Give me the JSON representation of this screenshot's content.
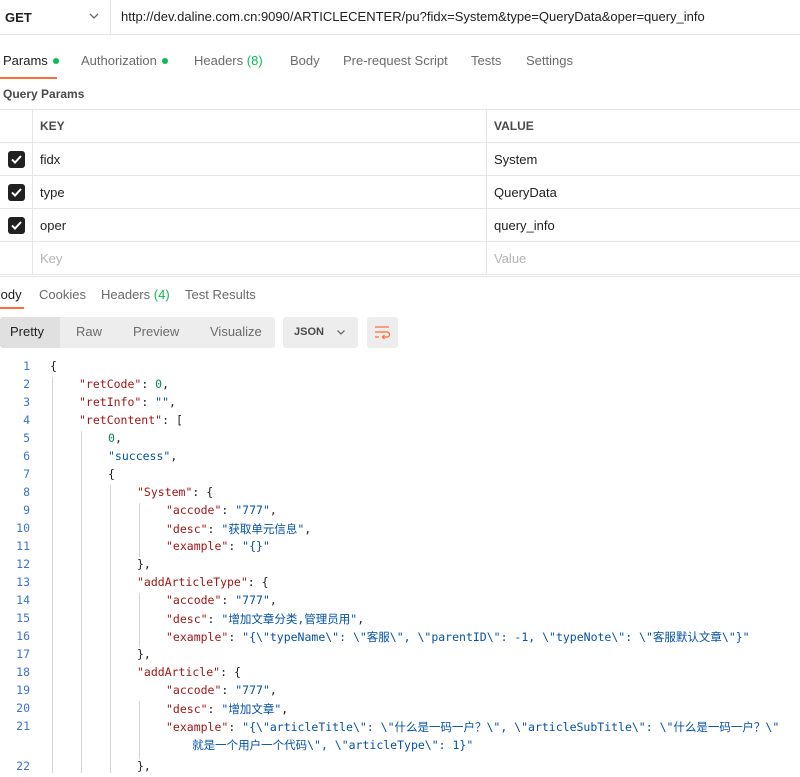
{
  "request": {
    "method": "GET",
    "url": "http://dev.daline.com.cn:9090/ARTICLECENTER/pu?fidx=System&type=QueryData&oper=query_info"
  },
  "req_tabs": {
    "params": "Params",
    "authorization": "Authorization",
    "headers": "Headers",
    "headers_count": "(8)",
    "body": "Body",
    "prerequest": "Pre-request Script",
    "tests": "Tests",
    "settings": "Settings"
  },
  "query_params": {
    "title": "Query Params",
    "col_key": "KEY",
    "col_value": "VALUE",
    "rows": [
      {
        "key": "fidx",
        "value": "System"
      },
      {
        "key": "type",
        "value": "QueryData"
      },
      {
        "key": "oper",
        "value": "query_info"
      }
    ],
    "placeholder_key": "Key",
    "placeholder_value": "Value"
  },
  "resp_tabs": {
    "body": "Body",
    "cookies": "Cookies",
    "headers": "Headers",
    "headers_count": "(4)",
    "test_results": "Test Results"
  },
  "view_modes": [
    "Pretty",
    "Raw",
    "Preview",
    "Visualize"
  ],
  "format": "JSON",
  "code_lines": [
    {
      "n": "1",
      "d": 0,
      "p": [
        [
          "p",
          "{"
        ]
      ]
    },
    {
      "n": "2",
      "d": 1,
      "p": [
        [
          "k",
          "\"retCode\""
        ],
        [
          "p",
          ": "
        ],
        [
          "n",
          "0"
        ],
        [
          "p",
          ","
        ]
      ]
    },
    {
      "n": "3",
      "d": 1,
      "p": [
        [
          "k",
          "\"retInfo\""
        ],
        [
          "p",
          ": "
        ],
        [
          "s",
          "\"\""
        ],
        [
          "p",
          ","
        ]
      ]
    },
    {
      "n": "4",
      "d": 1,
      "p": [
        [
          "k",
          "\"retContent\""
        ],
        [
          "p",
          ": ["
        ]
      ]
    },
    {
      "n": "5",
      "d": 2,
      "p": [
        [
          "n",
          "0"
        ],
        [
          "p",
          ","
        ]
      ]
    },
    {
      "n": "6",
      "d": 2,
      "p": [
        [
          "s",
          "\"success\""
        ],
        [
          "p",
          ","
        ]
      ]
    },
    {
      "n": "7",
      "d": 2,
      "p": [
        [
          "p",
          "{"
        ]
      ]
    },
    {
      "n": "8",
      "d": 3,
      "p": [
        [
          "k",
          "\"System\""
        ],
        [
          "p",
          ": {"
        ]
      ]
    },
    {
      "n": "9",
      "d": 4,
      "p": [
        [
          "k",
          "\"accode\""
        ],
        [
          "p",
          ": "
        ],
        [
          "s",
          "\"777\""
        ],
        [
          "p",
          ","
        ]
      ]
    },
    {
      "n": "10",
      "d": 4,
      "p": [
        [
          "k",
          "\"desc\""
        ],
        [
          "p",
          ": "
        ],
        [
          "s",
          "\"获取单元信息\""
        ],
        [
          "p",
          ","
        ]
      ]
    },
    {
      "n": "11",
      "d": 4,
      "p": [
        [
          "k",
          "\"example\""
        ],
        [
          "p",
          ": "
        ],
        [
          "s",
          "\"{}\""
        ]
      ]
    },
    {
      "n": "12",
      "d": 3,
      "p": [
        [
          "p",
          "},"
        ]
      ]
    },
    {
      "n": "13",
      "d": 3,
      "p": [
        [
          "k",
          "\"addArticleType\""
        ],
        [
          "p",
          ": {"
        ]
      ]
    },
    {
      "n": "14",
      "d": 4,
      "p": [
        [
          "k",
          "\"accode\""
        ],
        [
          "p",
          ": "
        ],
        [
          "s",
          "\"777\""
        ],
        [
          "p",
          ","
        ]
      ]
    },
    {
      "n": "15",
      "d": 4,
      "p": [
        [
          "k",
          "\"desc\""
        ],
        [
          "p",
          ": "
        ],
        [
          "s",
          "\"增加文章分类,管理员用\""
        ],
        [
          "p",
          ","
        ]
      ]
    },
    {
      "n": "16",
      "d": 4,
      "p": [
        [
          "k",
          "\"example\""
        ],
        [
          "p",
          ": "
        ],
        [
          "s",
          "\"{\\\"typeName\\\": \\\"客服\\\", \\\"parentID\\\": -1, \\\"typeNote\\\": \\\"客服默认文章\\\"}\""
        ]
      ]
    },
    {
      "n": "17",
      "d": 3,
      "p": [
        [
          "p",
          "},"
        ]
      ]
    },
    {
      "n": "18",
      "d": 3,
      "p": [
        [
          "k",
          "\"addArticle\""
        ],
        [
          "p",
          ": {"
        ]
      ]
    },
    {
      "n": "19",
      "d": 4,
      "p": [
        [
          "k",
          "\"accode\""
        ],
        [
          "p",
          ": "
        ],
        [
          "s",
          "\"777\""
        ],
        [
          "p",
          ","
        ]
      ]
    },
    {
      "n": "20",
      "d": 4,
      "p": [
        [
          "k",
          "\"desc\""
        ],
        [
          "p",
          ": "
        ],
        [
          "s",
          "\"增加文章\""
        ],
        [
          "p",
          ","
        ]
      ]
    },
    {
      "n": "21",
      "d": 4,
      "p": [
        [
          "k",
          "\"example\""
        ],
        [
          "p",
          ": "
        ],
        [
          "s",
          "\"{\\\"articleTitle\\\": \\\"什么是一码一户？\\\", \\\"articleSubTitle\\\": \\\"什么是一码一户？\\\""
        ]
      ]
    },
    {
      "n": "",
      "d": 5,
      "p": [
        [
          "s",
          "就是一个用户一个代码\\\", \\\"articleType\\\": 1}\""
        ]
      ]
    },
    {
      "n": "22",
      "d": 3,
      "p": [
        [
          "p",
          "},"
        ]
      ]
    }
  ]
}
